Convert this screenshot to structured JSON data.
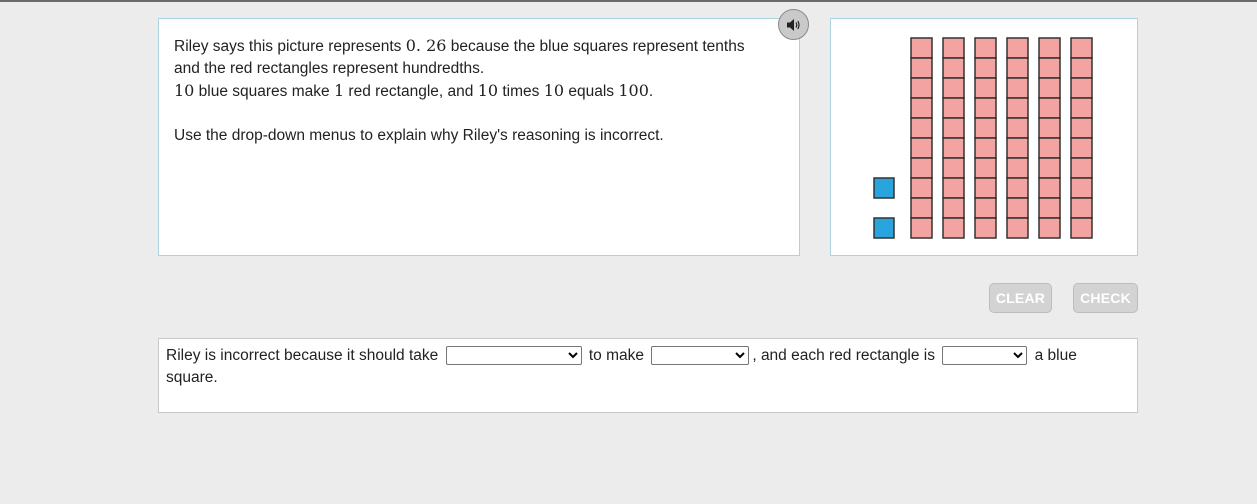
{
  "prompt": {
    "line1_a": "Riley says this picture represents ",
    "line1_num": "0. 26",
    "line1_b": " because the blue squares represent tenths",
    "line2": "and the red rectangles represent hundredths.",
    "line3_num1": "10",
    "line3_a": " blue squares make ",
    "line3_num2": "1",
    "line3_b": " red rectangle, and ",
    "line3_num3": "10",
    "line3_c": " times ",
    "line3_num4": "10",
    "line3_d": " equals ",
    "line3_num5": "100",
    "line3_e": ".",
    "instruction": "Use the drop-down menus to explain why Riley's reasoning is incorrect."
  },
  "model": {
    "blue_square_count": 2,
    "red_rectangle_count": 6,
    "cells_per_rectangle": 10,
    "blue_color": "#29a4dc",
    "red_color": "#f4a3a3",
    "outline_color": "#333333"
  },
  "audio": {
    "icon": "speaker-icon"
  },
  "buttons": {
    "clear": "CLEAR",
    "check": "CHECK"
  },
  "answer": {
    "part1": "Riley is incorrect because it should take",
    "part2": "to make",
    "part3": ", and each red rectangle is",
    "part4": "a blue",
    "part5": "square.",
    "dropdown1_value": "",
    "dropdown2_value": "",
    "dropdown3_value": ""
  }
}
